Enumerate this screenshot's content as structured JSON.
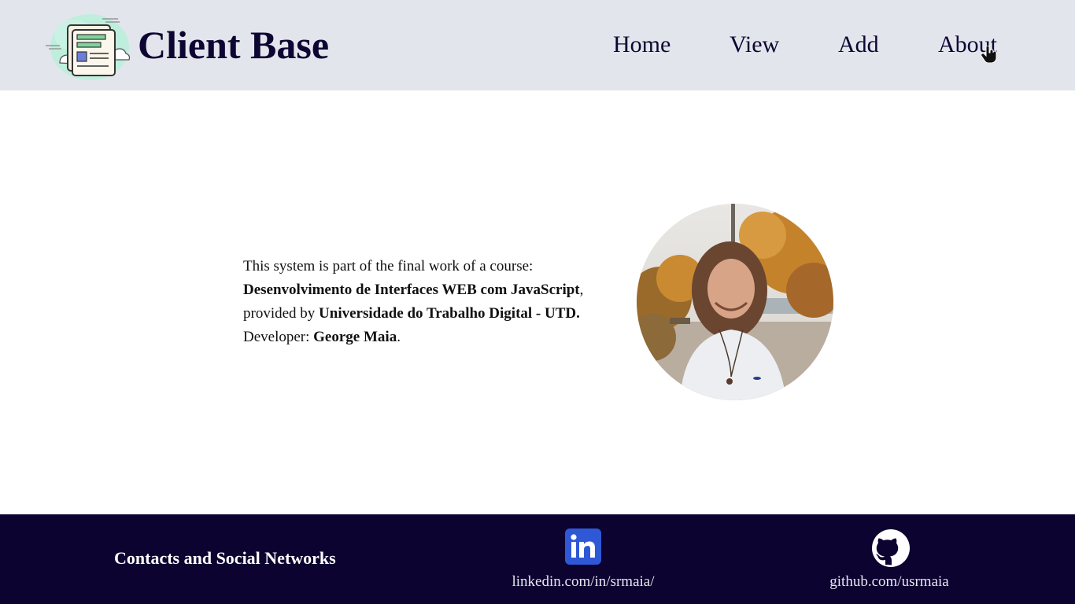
{
  "header": {
    "brand_title": "Client Base",
    "nav": [
      {
        "label": "Home"
      },
      {
        "label": "View"
      },
      {
        "label": "Add"
      },
      {
        "label": "About"
      }
    ]
  },
  "about": {
    "line1": "This system is part of the final work of a course:",
    "course_name": "Desenvolvimento de Interfaces WEB com JavaScript",
    "comma": ",",
    "provided_by": "provided by ",
    "institution": "Universidade do Trabalho Digital - UTD.",
    "developer_label": "Developer: ",
    "developer_name": "George Maia",
    "period": "."
  },
  "footer": {
    "title": "Contacts and Social Networks",
    "links": [
      {
        "icon": "linkedin-icon",
        "label": "linkedin.com/in/srmaia/"
      },
      {
        "icon": "github-icon",
        "label": "github.com/usrmaia"
      }
    ]
  },
  "colors": {
    "header_bg": "#e3e5ec",
    "brand_text": "#0d0532",
    "footer_bg": "#0d0330",
    "linkedin_blue": "#2f58d6"
  }
}
